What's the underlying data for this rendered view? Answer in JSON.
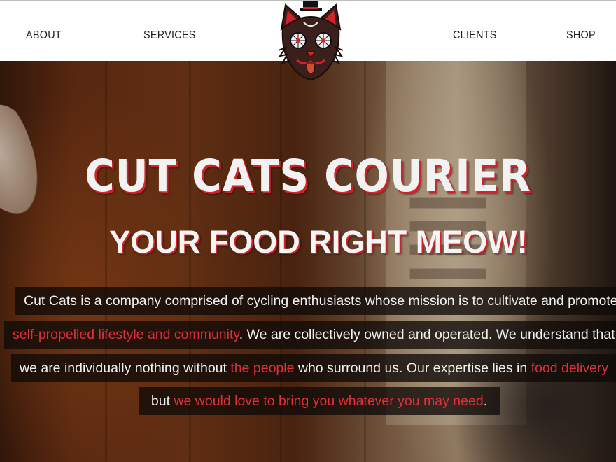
{
  "nav": {
    "about": "ABOUT",
    "services": "SERVICES",
    "clients": "CLIENTS",
    "shop": "SHOP"
  },
  "logo": {
    "icon": "cat-logo-icon"
  },
  "hero": {
    "title": "CUT CATS COURIER",
    "subtitle": "YOUR FOOD RIGHT MEOW!"
  },
  "mission": {
    "line1": "Cut Cats is a company comprised of cycling enthusiasts whose mission is to cultivate and promote a",
    "line2_link": "self-propelled lifestyle and community",
    "line2_text": ". We are collectively owned and operated. We understand that",
    "line3_text_a": "we are individually nothing without ",
    "line3_link1": "the people",
    "line3_text_b": " who surround us. Our expertise lies in ",
    "line3_link2": "food delivery",
    "line4_text_a": "but ",
    "line4_link": "we would love to bring you whatever you may need",
    "line4_text_b": "."
  },
  "colors": {
    "accent": "#d2232a",
    "header_bg": "#ffffff",
    "nav_text": "#1c1c1c"
  }
}
